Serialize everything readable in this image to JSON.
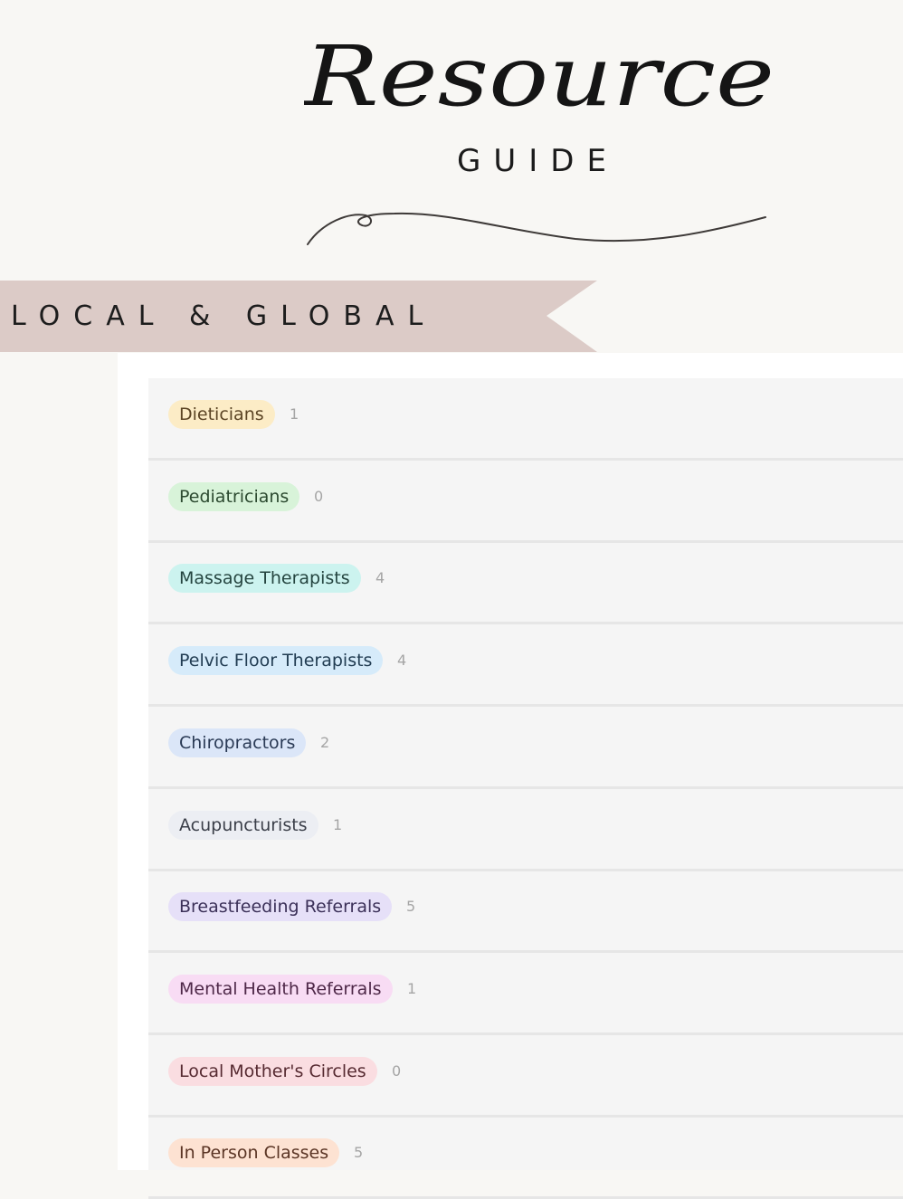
{
  "header": {
    "title_script": "Resource",
    "subtitle": "GUIDE"
  },
  "banner": {
    "label": "LOCAL & GLOBAL",
    "color": "#dccbc7"
  },
  "groups": [
    {
      "label": "Dieticians",
      "count": "1",
      "bg": "#fcecc6",
      "fg": "#5b4424"
    },
    {
      "label": "Pediatricians",
      "count": "0",
      "bg": "#d8f3d9",
      "fg": "#2c4a30"
    },
    {
      "label": "Massage Therapists",
      "count": "4",
      "bg": "#ccf3ef",
      "fg": "#24443f"
    },
    {
      "label": "Pelvic Floor Therapists",
      "count": "4",
      "bg": "#d6ebfa",
      "fg": "#213c52"
    },
    {
      "label": "Chiropractors",
      "count": "2",
      "bg": "#dbe6f8",
      "fg": "#2a3a55"
    },
    {
      "label": "Acupuncturists",
      "count": "1",
      "bg": "#eceef3",
      "fg": "#3a3e48"
    },
    {
      "label": "Breastfeeding Referrals",
      "count": "5",
      "bg": "#e6e0f8",
      "fg": "#3b3058"
    },
    {
      "label": "Mental Health Referrals",
      "count": "1",
      "bg": "#f8dcf4",
      "fg": "#4e2848"
    },
    {
      "label": "Local Mother's Circles",
      "count": "0",
      "bg": "#fadde1",
      "fg": "#562a31"
    },
    {
      "label": "In Person Classes",
      "count": "5",
      "bg": "#fde2d2",
      "fg": "#5a3424"
    }
  ]
}
